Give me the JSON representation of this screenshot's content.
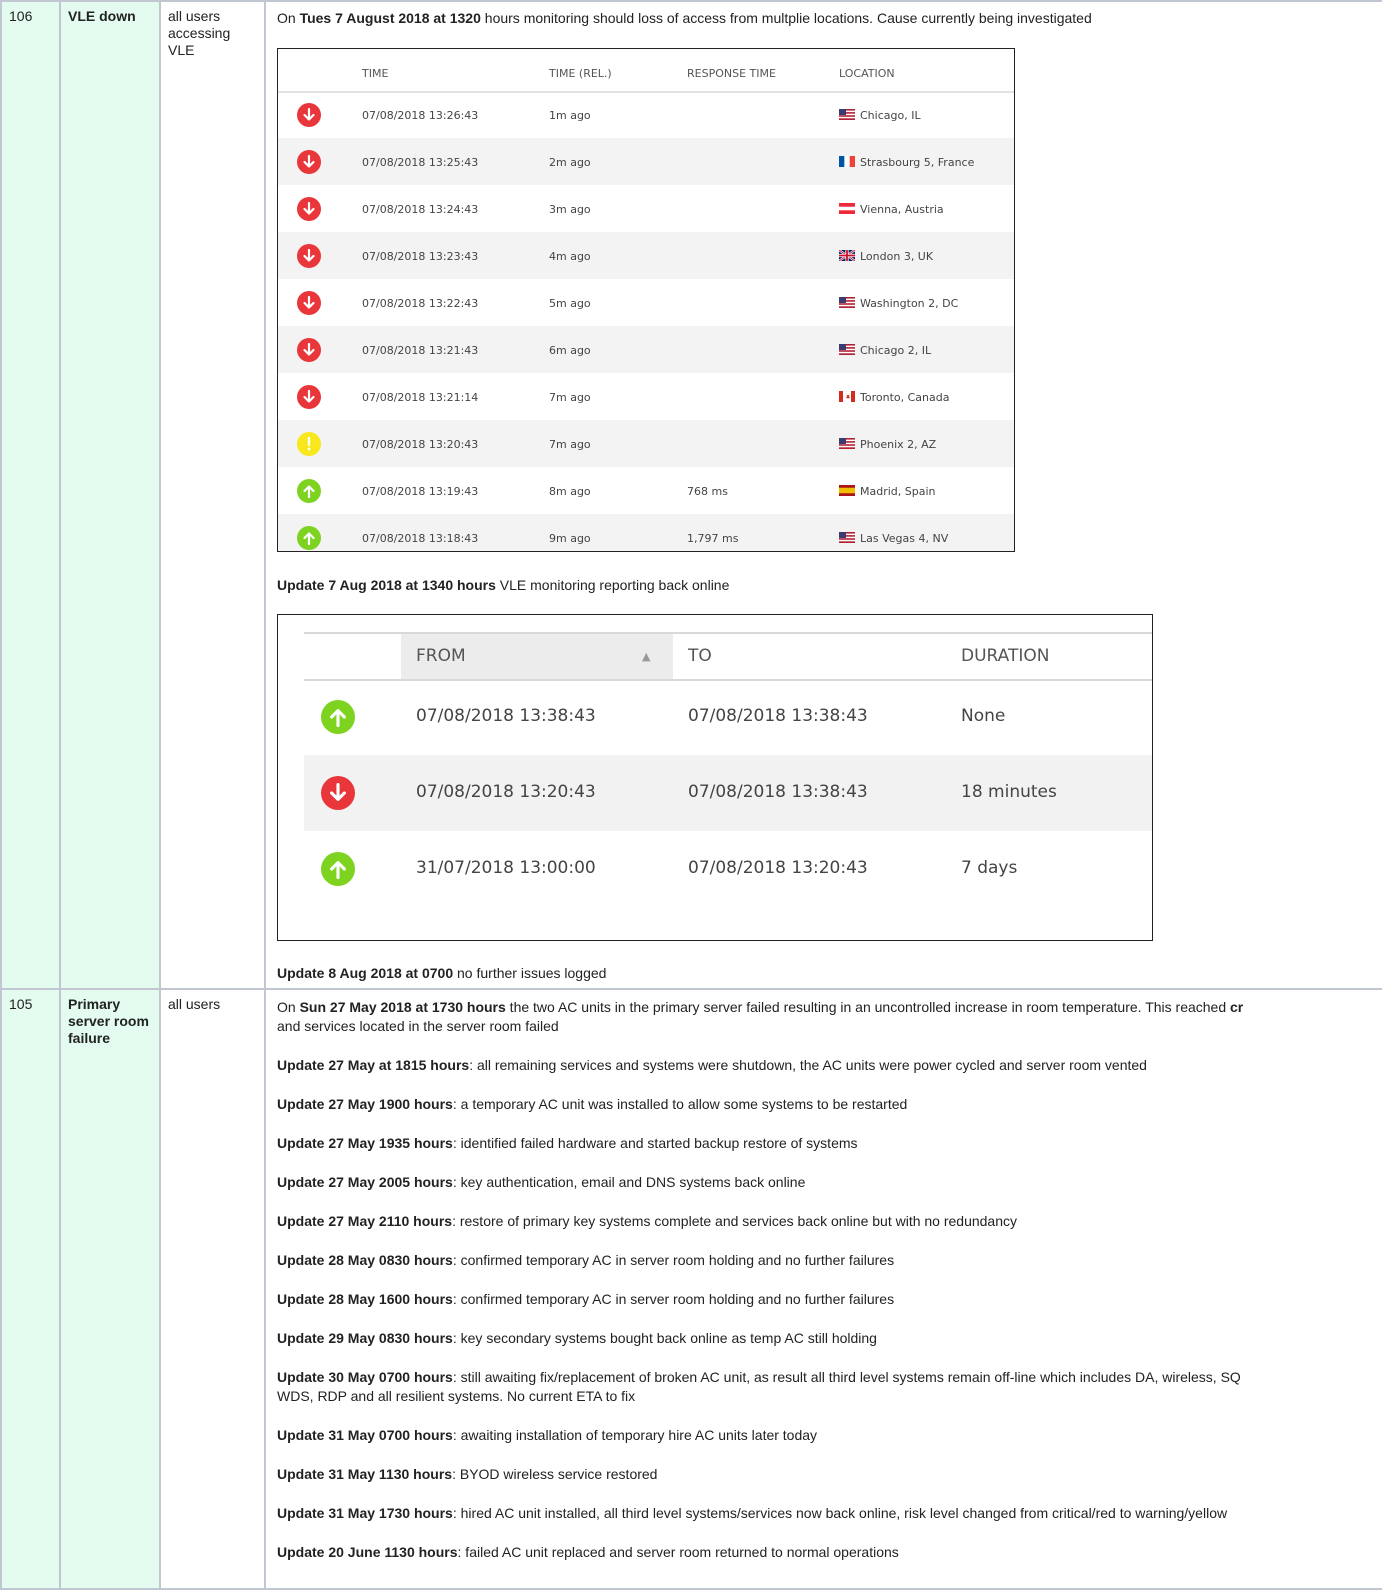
{
  "incidents": [
    {
      "id": "106",
      "title": "VLE down",
      "affected": "all users accessing VLE",
      "intro": {
        "pre": "On ",
        "bold": "Tues 7 August 2018 at 1320",
        "post": " hours monitoring should loss of access from multplie locations. Cause currently being investigated"
      },
      "checks_table": {
        "headers": [
          "TIME",
          "TIME (REL.)",
          "RESPONSE TIME",
          "LOCATION"
        ],
        "rows": [
          {
            "status": "down",
            "time": "07/08/2018 13:26:43",
            "rel": "1m ago",
            "response": "",
            "location": "Chicago, IL",
            "flag": "us"
          },
          {
            "status": "down",
            "time": "07/08/2018 13:25:43",
            "rel": "2m ago",
            "response": "",
            "location": "Strasbourg 5, France",
            "flag": "fr"
          },
          {
            "status": "down",
            "time": "07/08/2018 13:24:43",
            "rel": "3m ago",
            "response": "",
            "location": "Vienna, Austria",
            "flag": "at"
          },
          {
            "status": "down",
            "time": "07/08/2018 13:23:43",
            "rel": "4m ago",
            "response": "",
            "location": "London 3, UK",
            "flag": "uk"
          },
          {
            "status": "down",
            "time": "07/08/2018 13:22:43",
            "rel": "5m ago",
            "response": "",
            "location": "Washington 2, DC",
            "flag": "us"
          },
          {
            "status": "down",
            "time": "07/08/2018 13:21:43",
            "rel": "6m ago",
            "response": "",
            "location": "Chicago 2, IL",
            "flag": "us"
          },
          {
            "status": "down",
            "time": "07/08/2018 13:21:14",
            "rel": "7m ago",
            "response": "",
            "location": "Toronto, Canada",
            "flag": "ca"
          },
          {
            "status": "warning",
            "time": "07/08/2018 13:20:43",
            "rel": "7m ago",
            "response": "",
            "location": "Phoenix 2, AZ",
            "flag": "us"
          },
          {
            "status": "up",
            "time": "07/08/2018 13:19:43",
            "rel": "8m ago",
            "response": "768 ms",
            "location": "Madrid, Spain",
            "flag": "es"
          },
          {
            "status": "up",
            "time": "07/08/2018 13:18:43",
            "rel": "9m ago",
            "response": "1,797 ms",
            "location": "Las Vegas 4, NV",
            "flag": "us"
          }
        ]
      },
      "update1": {
        "bold": "Update 7 Aug 2018 at 1340 hours",
        "post": " VLE monitoring reporting back online"
      },
      "periods_table": {
        "headers": [
          "FROM",
          "TO",
          "DURATION"
        ],
        "sort_indicator": "▲",
        "rows": [
          {
            "status": "up",
            "from": "07/08/2018 13:38:43",
            "to": "07/08/2018 13:38:43",
            "duration": "None"
          },
          {
            "status": "down",
            "from": "07/08/2018 13:20:43",
            "to": "07/08/2018 13:38:43",
            "duration": "18 minutes"
          },
          {
            "status": "up",
            "from": "31/07/2018 13:00:00",
            "to": "07/08/2018 13:20:43",
            "duration": "7 days"
          }
        ]
      },
      "update2": {
        "bold": "Update 8 Aug 2018 at 0700",
        "post": " no further issues logged"
      }
    },
    {
      "id": "105",
      "title": "Primary server room failure",
      "affected": "all users",
      "intro": {
        "pre": "On ",
        "bold": "Sun 27 May 2018 at 1730 hours",
        "post": " the two AC units in the primary server failed resulting in an uncontrolled increase in room temperature. This reached ",
        "bold2": "cr",
        "line2": "and services located in the server room failed"
      },
      "updates": [
        {
          "bold": "Update 27 May at 1815 hours",
          "post": ": all remaining services and systems were shutdown, the AC units were power cycled and server room vented"
        },
        {
          "bold": "Update 27 May 1900 hours",
          "post": ": a temporary AC unit was installed to allow some systems to be restarted"
        },
        {
          "bold": "Update 27 May 1935 hours",
          "post": ": identified failed hardware and started backup restore of systems"
        },
        {
          "bold": "Update 27 May 2005 hours",
          "post": ": key authentication, email and DNS systems back online"
        },
        {
          "bold": "Update 27 May 2110 hours",
          "post": ": restore of primary key systems complete and services back online but with no redundancy"
        },
        {
          "bold": "Update 28 May 0830 hours",
          "post": ": confirmed temporary AC in server room holding and no further failures"
        },
        {
          "bold": "Update 28 May 1600 hours",
          "post": ": confirmed temporary AC in server room holding and no further failures"
        },
        {
          "bold": "Update 29 May 0830 hours",
          "post": ": key secondary systems bought back online as temp AC still holding"
        },
        {
          "bold": "Update 30 May 0700 hours",
          "post": ": still awaiting fix/replacement of broken AC unit, as result all third level systems remain off-line which includes DA, wireless, SQ",
          "line2": "WDS, RDP and all resilient systems. No current ETA to fix"
        },
        {
          "bold": "Update 31 May 0700 hours",
          "post": ": awaiting installation of temporary hire AC units later today"
        },
        {
          "bold": "Update 31 May 1130 hours",
          "post": ": BYOD wireless service restored"
        },
        {
          "bold": "Update 31 May 1730 hours",
          "post": ": hired AC unit installed, all third level systems/services now back online, risk level changed from critical/red to warning/yellow"
        },
        {
          "bold": "Update 20 June 1130 hours",
          "post": ": failed AC unit replaced and server room returned to normal operations"
        }
      ]
    }
  ],
  "colors": {
    "down": "#e8363b",
    "up": "#7ed321",
    "warning": "#f8e71c",
    "accent_cell": "#e3fcef"
  }
}
